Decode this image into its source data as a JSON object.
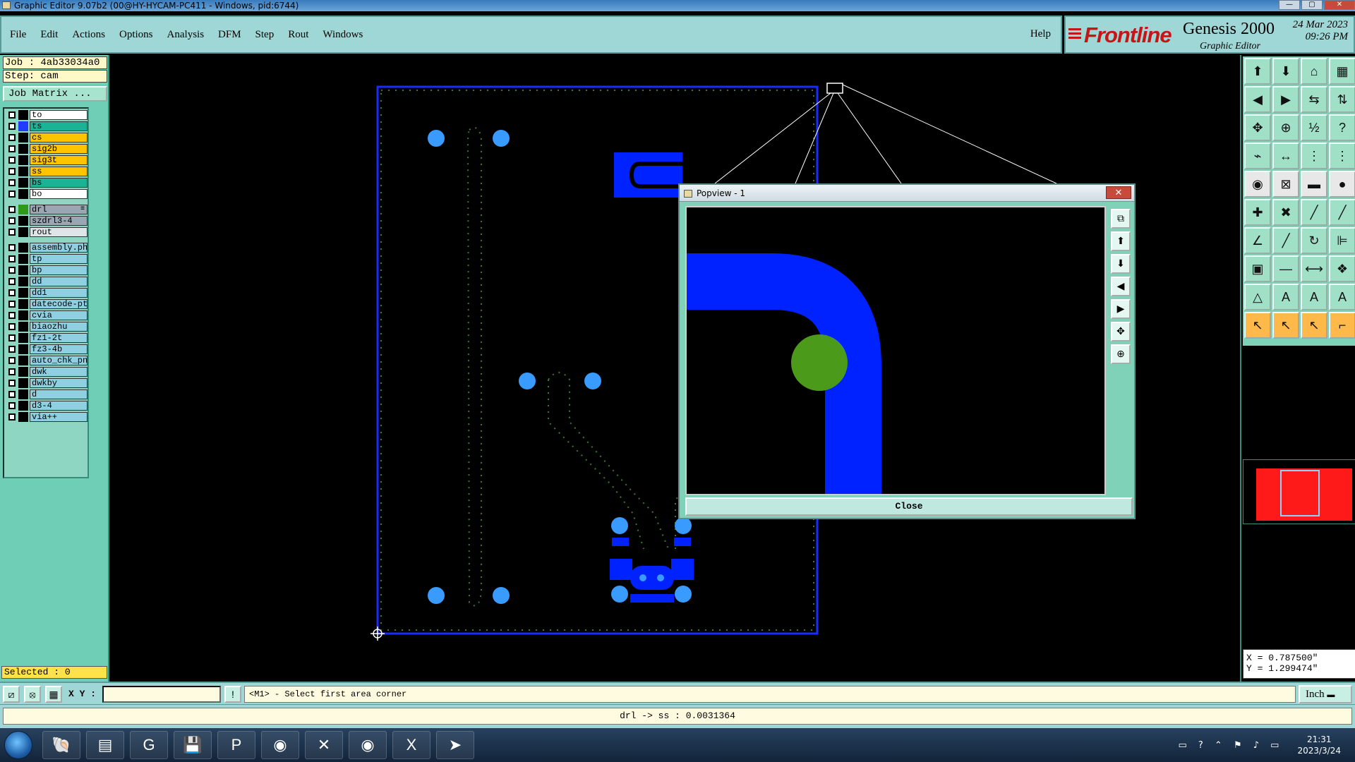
{
  "window": {
    "title": "Graphic Editor 9.07b2 (00@HY-HYCAM-PC411 - Windows, pid:6744)"
  },
  "menu": [
    "File",
    "Edit",
    "Actions",
    "Options",
    "Analysis",
    "DFM",
    "Step",
    "Rout",
    "Windows"
  ],
  "help": "Help",
  "brand": {
    "logo": "Frontline",
    "product": "Genesis 2000",
    "subtitle": "Graphic Editor",
    "date": "24 Mar 2023",
    "time": "09:26 PM"
  },
  "job": {
    "job_line": "Job : 4ab33034a0",
    "step_line": "Step: cam",
    "matrix_button": "Job Matrix ..."
  },
  "layers": [
    {
      "name": "to",
      "bg": "#ffffff",
      "sw": "#000000"
    },
    {
      "name": "ts",
      "bg": "#1bb396",
      "sw": "#1f3cff"
    },
    {
      "name": "cs",
      "bg": "#ffc400",
      "sw": "#000000"
    },
    {
      "name": "sig2b",
      "bg": "#ffc400",
      "sw": "#000000"
    },
    {
      "name": "sig3t",
      "bg": "#ffc400",
      "sw": "#000000"
    },
    {
      "name": "ss",
      "bg": "#ffc400",
      "sw": "#000000"
    },
    {
      "name": "bs",
      "bg": "#1bb396",
      "sw": "#000000"
    },
    {
      "name": "bo",
      "bg": "#ffffff",
      "sw": "#000000"
    },
    {
      "name": "drl",
      "bg": "#9aa6b2",
      "sw": "#2f9a17",
      "flag": "≡"
    },
    {
      "name": "szdrl3-4",
      "bg": "#9aa6b2",
      "sw": "#000000"
    },
    {
      "name": "rout",
      "bg": "#dfe4e8",
      "sw": "#000000"
    },
    {
      "name": "assembly.pho",
      "bg": "#8fd0e0",
      "sw": "#000000"
    },
    {
      "name": "tp",
      "bg": "#8fd0e0",
      "sw": "#000000"
    },
    {
      "name": "bp",
      "bg": "#8fd0e0",
      "sw": "#000000"
    },
    {
      "name": "dd",
      "bg": "#8fd0e0",
      "sw": "#000000"
    },
    {
      "name": "dd1",
      "bg": "#8fd0e0",
      "sw": "#000000"
    },
    {
      "name": "datecode-pte",
      "bg": "#8fd0e0",
      "sw": "#000000"
    },
    {
      "name": "cvia",
      "bg": "#8fd0e0",
      "sw": "#000000"
    },
    {
      "name": "biaozhu",
      "bg": "#8fd0e0",
      "sw": "#000000"
    },
    {
      "name": "fz1-2t",
      "bg": "#8fd0e0",
      "sw": "#000000"
    },
    {
      "name": "fz3-4b",
      "bg": "#8fd0e0",
      "sw": "#000000"
    },
    {
      "name": "auto_chk_pnl",
      "bg": "#8fd0e0",
      "sw": "#000000"
    },
    {
      "name": "dwk",
      "bg": "#8fd0e0",
      "sw": "#000000"
    },
    {
      "name": "dwkby",
      "bg": "#8fd0e0",
      "sw": "#000000"
    },
    {
      "name": "d",
      "bg": "#8fd0e0",
      "sw": "#000000"
    },
    {
      "name": "d3-4",
      "bg": "#8fd0e0",
      "sw": "#000000"
    },
    {
      "name": "via++",
      "bg": "#8fd0e0",
      "sw": "#000000"
    }
  ],
  "selected": "Selected : 0",
  "popview": {
    "title": "Popview - 1",
    "close_label": "Close",
    "close_x": "✕"
  },
  "coords": {
    "x": "X = 0.787500\"",
    "y": "Y = 1.299474\""
  },
  "command": {
    "xy_label": "X Y :",
    "xy_value": "",
    "prompt": "<M1> - Select first area corner",
    "unit": "Inch"
  },
  "status": "drl -> ss : 0.0031364",
  "taskbar": {
    "time": "21:31",
    "date": "2023/3/24"
  },
  "colors": {
    "pad": "#3a9bff",
    "copper": "#0022ff",
    "outline": "#0b25ff",
    "drill": "#4b9a1a",
    "accent_bg": "#9fd6d6"
  }
}
